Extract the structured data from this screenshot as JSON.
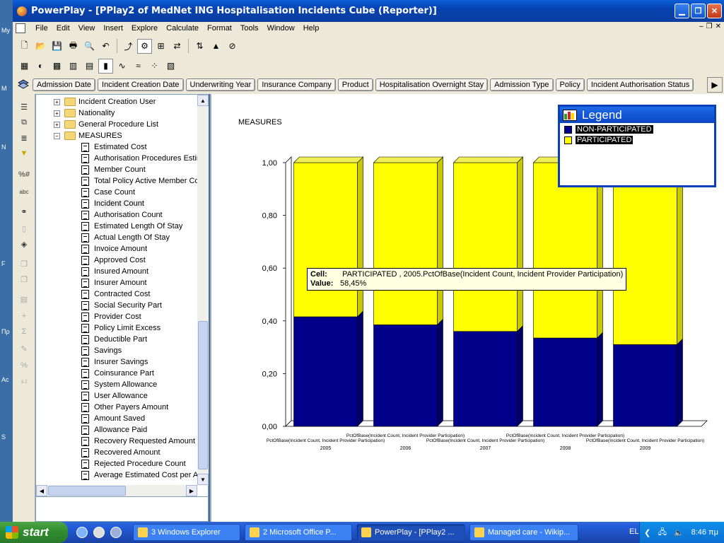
{
  "window": {
    "title": "PowerPlay - [PPlay2 of MedNet ING Hospitalisation Incidents Cube (Reporter)]"
  },
  "desktop_strip": [
    "My",
    "M",
    "N",
    "F",
    "Πρ",
    "Ac",
    "S"
  ],
  "menu": [
    "File",
    "Edit",
    "View",
    "Insert",
    "Explore",
    "Calculate",
    "Format",
    "Tools",
    "Window",
    "Help"
  ],
  "dimension_tabs": [
    "Admission Date",
    "Incident Creation Date",
    "Underwriting Year",
    "Insurance Company",
    "Product",
    "Hospitalisation Overnight Stay",
    "Admission Type",
    "Policy",
    "Incident Authorisation Status"
  ],
  "tree": {
    "folders": [
      {
        "label": "Incident Creation User",
        "expanded": false
      },
      {
        "label": "Nationality",
        "expanded": false
      },
      {
        "label": "General Procedure List",
        "expanded": false
      },
      {
        "label": "MEASURES",
        "expanded": true
      }
    ],
    "measures": [
      "Estimated Cost",
      "Authorisation Procedures Estim",
      "Member Count",
      "Total Policy Active Member Co",
      "Case Count",
      "Incident Count",
      "Authorisation Count",
      "Estimated Length Of Stay",
      "Actual Length Of Stay",
      "Invoice Amount",
      "Approved Cost",
      "Insured Amount",
      "Insurer Amount",
      "Contracted Cost",
      "Social Security Part",
      "Provider Cost",
      "Policy Limit Excess",
      "Deductible Part",
      "Savings",
      "Insurer Savings",
      "Coinsurance Part",
      "System Allowance",
      "User Allowance",
      "Other Payers Amount",
      "Amount Saved",
      "Allowance Paid",
      "Recovery Requested Amount",
      "Recovered Amount",
      "Rejected Procedure Count",
      "Average Estimated Cost per A"
    ],
    "selected": "Incident Count"
  },
  "chart_panel": {
    "measures_label": "MEASURES",
    "x_axis_label": "PctOfBase(Incident Count, Incident Provider Participation)"
  },
  "chart_data": {
    "type": "bar",
    "stacked": true,
    "percent_stacked": true,
    "categories": [
      "2005",
      "2006",
      "2007",
      "2008",
      "2009"
    ],
    "series": [
      {
        "name": "NON-PARTICIPATED",
        "color": "#00008b",
        "values": [
          0.4155,
          0.385,
          0.36,
          0.335,
          0.31
        ]
      },
      {
        "name": "PARTICIPATED",
        "color": "#ffff00",
        "values": [
          0.5845,
          0.615,
          0.64,
          0.665,
          0.69
        ]
      }
    ],
    "y_ticks": [
      "0,00",
      "0,20",
      "0,40",
      "0,60",
      "0,80",
      "1,00"
    ],
    "ylim": [
      0,
      1
    ],
    "legend_position": "top-right"
  },
  "legend": {
    "title": "Legend",
    "entries": [
      {
        "label": "NON-PARTICIPATED",
        "color": "#00008b"
      },
      {
        "label": "PARTICIPATED",
        "color": "#ffff00"
      }
    ]
  },
  "tooltip": {
    "cell_label": "Cell:",
    "cell_value": "PARTICIPATED , 2005.PctOfBase(Incident Count, Incident Provider Participation)",
    "value_label": "Value:",
    "value_value": "58,45%"
  },
  "taskbar": {
    "start": "start",
    "tasks": [
      {
        "label": "3 Windows Explorer",
        "active": false
      },
      {
        "label": "2 Microsoft Office P...",
        "active": false
      },
      {
        "label": "PowerPlay - [PPlay2 ...",
        "active": true
      },
      {
        "label": "Managed care - Wikip...",
        "active": false
      }
    ],
    "language": "EL",
    "clock": "8:46 πμ"
  }
}
